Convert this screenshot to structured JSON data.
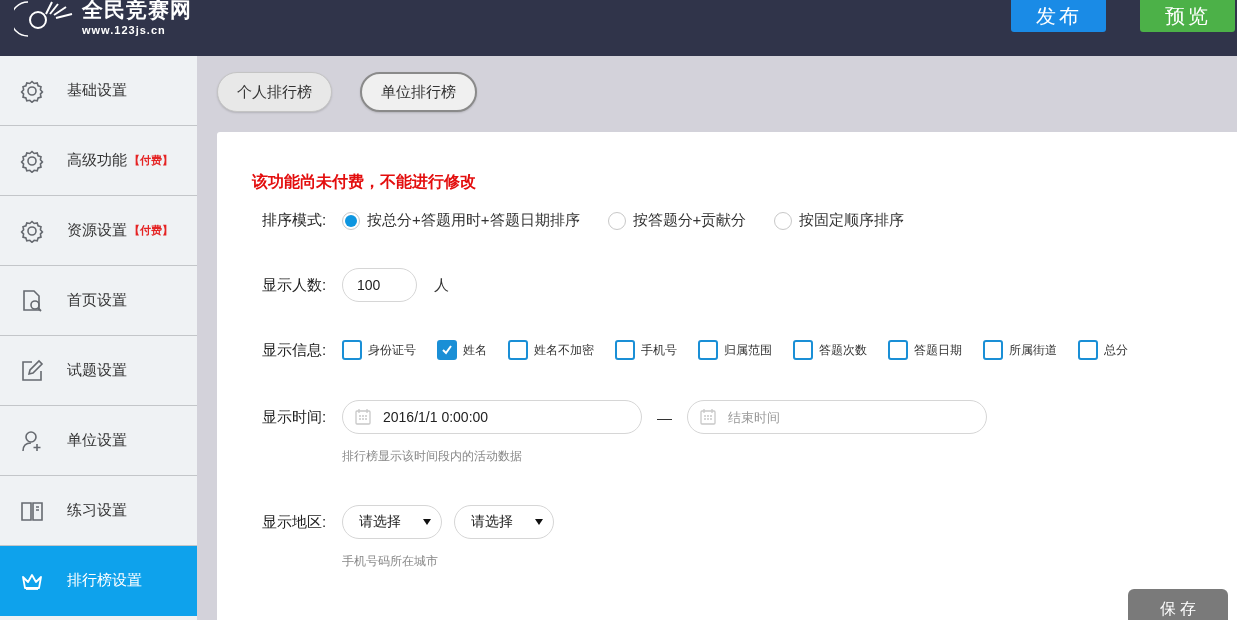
{
  "header": {
    "logo_title": "全民竞赛网",
    "logo_url": "www.123js.cn",
    "buttons": [
      {
        "label": "发布",
        "kind": "publish"
      },
      {
        "label": "预览",
        "kind": "preview"
      }
    ]
  },
  "sidebar": {
    "items": [
      {
        "label": "基础设置",
        "selected": false
      },
      {
        "label": "高级功能",
        "badge": "【付费】",
        "selected": false
      },
      {
        "label": "资源设置",
        "badge": "【付费】",
        "selected": false
      },
      {
        "label": "首页设置",
        "selected": false
      },
      {
        "label": "试题设置",
        "selected": false
      },
      {
        "label": "单位设置",
        "selected": false
      },
      {
        "label": "练习设置",
        "selected": false
      },
      {
        "label": "排行榜设置",
        "selected": true
      }
    ]
  },
  "tabs": [
    {
      "label": "个人排行榜",
      "selected": false
    },
    {
      "label": "单位排行榜",
      "selected": true
    }
  ],
  "warning": "该功能尚未付费，不能进行修改",
  "sort_mode": {
    "label": "排序模式:",
    "options": [
      {
        "label": "按总分+答题用时+答题日期排序",
        "selected": true
      },
      {
        "label": "按答题分+贡献分",
        "selected": false
      },
      {
        "label": "按固定顺序排序",
        "selected": false
      }
    ]
  },
  "display_count": {
    "label": "显示人数:",
    "value": "100",
    "unit": "人"
  },
  "display_info": {
    "label": "显示信息:",
    "options": [
      {
        "label": "身份证号",
        "checked": false
      },
      {
        "label": "姓名",
        "checked": true
      },
      {
        "label": "姓名不加密",
        "checked": false
      },
      {
        "label": "手机号",
        "checked": false
      },
      {
        "label": "归属范围",
        "checked": false
      },
      {
        "label": "答题次数",
        "checked": false
      },
      {
        "label": "答题日期",
        "checked": false
      },
      {
        "label": "所属街道",
        "checked": false
      },
      {
        "label": "总分",
        "checked": false
      }
    ]
  },
  "display_time": {
    "label": "显示时间:",
    "start": {
      "value": "2016/1/1 0:00:00"
    },
    "separator": "—",
    "end": {
      "placeholder": "结束时间"
    },
    "hint": "排行榜显示该时间段内的活动数据"
  },
  "display_region": {
    "label": "显示地区:",
    "selects": [
      "请选择",
      "请选择"
    ],
    "hint": "手机号码所在城市"
  },
  "save_button": "保 存"
}
